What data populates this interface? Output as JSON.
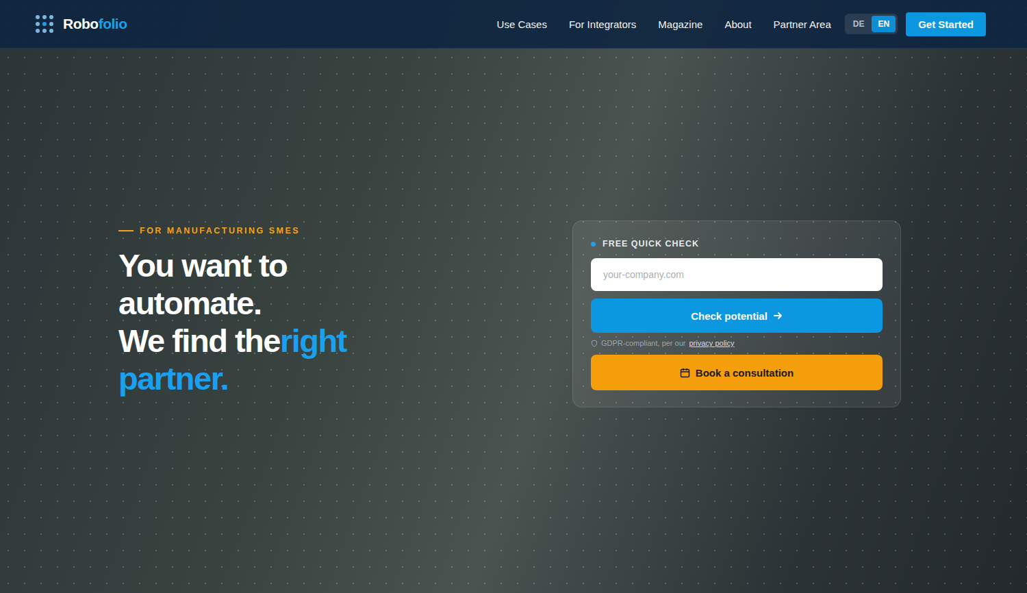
{
  "nav": {
    "logo": [
      "Robo",
      "folio"
    ],
    "links": [
      "Use Cases",
      "For Integrators",
      "Magazine",
      "About",
      "Partner Area"
    ],
    "languages": [
      {
        "label": "DE",
        "selected": false
      },
      {
        "label": "EN",
        "selected": true
      }
    ],
    "cta": "Get Started"
  },
  "hero": {
    "eyebrow": "FOR MANUFACTURING SMES",
    "headline": [
      "You want to automate.",
      "We find the"
    ],
    "highlight": "right partner."
  },
  "quickCheck": {
    "label": "FREE QUICK CHECK",
    "placeholder": "your-company.com",
    "submit": "Check potential",
    "note": "GDPR-compliant, per our",
    "noteLink": "privacy policy",
    "consultation": "Book a consultation"
  }
}
